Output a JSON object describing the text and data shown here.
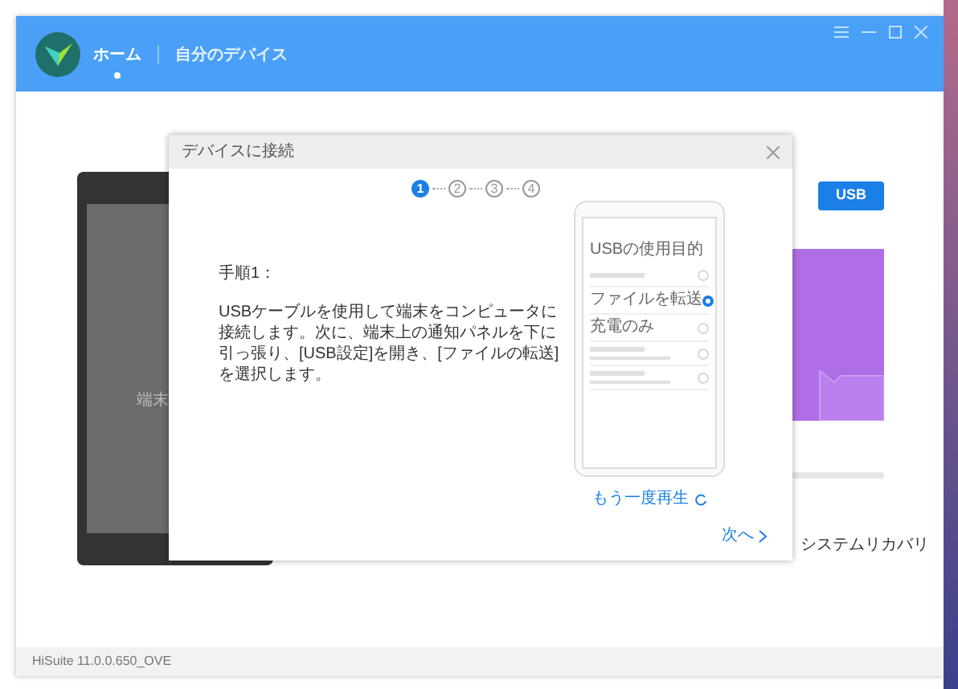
{
  "app": {
    "tabs": [
      {
        "label": "ホーム",
        "selected": true
      },
      {
        "label": "自分のデバイス",
        "selected": false
      }
    ]
  },
  "device_panel": {
    "phone_caption": "端末",
    "usb_button": "USB",
    "recovery_link": "システムリカバリ"
  },
  "dialog": {
    "title": "デバイスに接続",
    "steps": [
      {
        "label": "1",
        "selected": true
      },
      {
        "label": "2",
        "selected": false
      },
      {
        "label": "3",
        "selected": false
      },
      {
        "label": "4",
        "selected": false
      }
    ],
    "step_title": "手順1：",
    "instructions": "USBケーブルを使用して端末をコンピュータに接続します。次に、端末上の通知パネルを下に引っ張り、[USB設定]を開き、[ファイルの転送]を選択します。",
    "illustration": {
      "heading": "USBの使用目的",
      "options": [
        {
          "kind": "bar",
          "selected": false
        },
        {
          "kind": "text",
          "label": "ファイルを転送",
          "selected": true
        },
        {
          "kind": "text",
          "label": "充電のみ",
          "selected": false
        },
        {
          "kind": "bars",
          "selected": false
        },
        {
          "kind": "bars",
          "selected": false
        }
      ]
    },
    "replay": "もう一度再生",
    "next": "次へ"
  },
  "status_bar": {
    "version": "HiSuite 11.0.0.650_OVE"
  }
}
